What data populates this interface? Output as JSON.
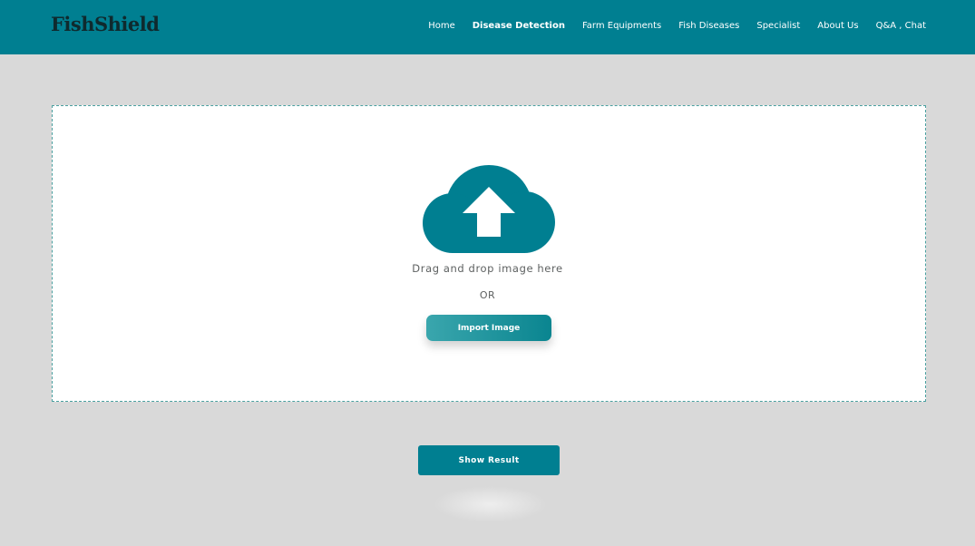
{
  "brand": {
    "logo_text": "FishShield"
  },
  "nav": {
    "links": [
      {
        "label": "Home",
        "active": false
      },
      {
        "label": "Disease Detection",
        "active": true
      },
      {
        "label": "Farm Equipments",
        "active": false
      },
      {
        "label": "Fish Diseases",
        "active": false
      },
      {
        "label": "Specialist",
        "active": false
      },
      {
        "label": "About Us",
        "active": false
      },
      {
        "label": "Q&A , Chat",
        "active": false
      }
    ]
  },
  "upload": {
    "icon": "cloud-upload-icon",
    "drop_text": "Drag and drop image here",
    "or_text": "OR",
    "import_label": "Import Image"
  },
  "actions": {
    "show_result_label": "Show Result"
  },
  "colors": {
    "primary": "#007f91",
    "background": "#d9d9d9",
    "panel": "#ffffff",
    "text_muted": "#5e6161"
  }
}
